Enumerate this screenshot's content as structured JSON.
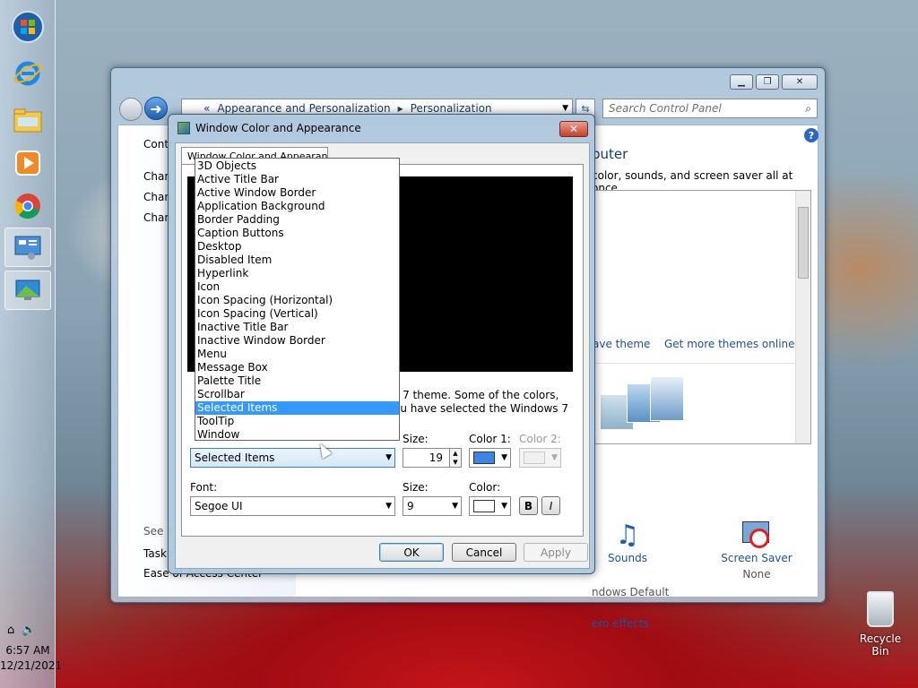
{
  "taskbar": {
    "clock_time": "6:57 AM",
    "clock_date": "12/21/2021",
    "items": [
      {
        "icon": "start-orb-icon"
      },
      {
        "icon": "internet-explorer-icon"
      },
      {
        "icon": "file-explorer-icon"
      },
      {
        "icon": "media-player-icon"
      },
      {
        "icon": "chrome-icon"
      },
      {
        "icon": "control-panel-icon"
      },
      {
        "icon": "personalization-icon"
      }
    ]
  },
  "control_panel": {
    "breadcrumb": {
      "prefix": "«",
      "level1": "Appearance and Personalization",
      "separator": "▸",
      "level2": "Personalization"
    },
    "search_placeholder": "Search Control Panel",
    "left_links": [
      "Contr",
      "Chan",
      "Chan",
      "Chan"
    ],
    "see_also": "See a",
    "taskbar_link": "Taskb",
    "ease_link": "Ease of Access Center",
    "right_title": "puter",
    "right_desc": "color, sounds, and screen saver all at once.",
    "save_theme": "ave theme",
    "get_more_themes": "Get more themes online",
    "sounds_label": "Sounds",
    "sounds_value": "ndows Default",
    "screensaver_label": "Screen Saver",
    "screensaver_value": "None",
    "aero_effects": "ero effects"
  },
  "dialog": {
    "title": "Window Color and Appearance",
    "close_glyph": "✕",
    "tab_label": "Window Color and Appearance",
    "description_line1": "s 7 theme.  Some of the colors,",
    "description_line2": "ou have selected the Windows 7",
    "size_label": "Size:",
    "size_value": "19",
    "color1_label": "Color 1:",
    "color2_label": "Color 2:",
    "item_selected": "Selected Items",
    "font_label": "Font:",
    "font_value": "Segoe UI",
    "font_size_label": "Size:",
    "font_size_value": "9",
    "font_color_label": "Color:",
    "bold_label": "B",
    "italic_label": "I",
    "ok_label": "OK",
    "cancel_label": "Cancel",
    "apply_label": "Apply",
    "color1_hex": "#3a86e6"
  },
  "dropdown_items": [
    "3D Objects",
    "Active Title Bar",
    "Active Window Border",
    "Application Background",
    "Border Padding",
    "Caption Buttons",
    "Desktop",
    "Disabled Item",
    "Hyperlink",
    "Icon",
    "Icon Spacing (Horizontal)",
    "Icon Spacing (Vertical)",
    "Inactive Title Bar",
    "Inactive Window Border",
    "Menu",
    "Message Box",
    "Palette Title",
    "Scrollbar",
    "Selected Items",
    "ToolTip",
    "Window"
  ],
  "dropdown_selected_index": 18,
  "desktop": {
    "recycle_bin_label": "Recycle Bin"
  }
}
